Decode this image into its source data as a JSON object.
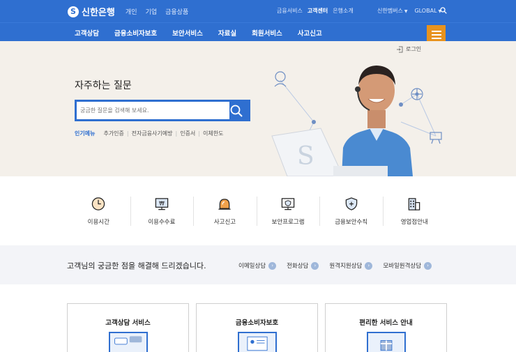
{
  "header": {
    "logo": "신한은행",
    "logo_mark": "S",
    "top_nav": [
      "개인",
      "기업",
      "금융상품"
    ],
    "top_right": [
      {
        "label": "금융서비스",
        "active": false
      },
      {
        "label": "고객센터",
        "active": true
      },
      {
        "label": "은행소개",
        "active": false
      }
    ],
    "util": [
      "신한멤버스",
      "GLOBAL"
    ]
  },
  "main_nav": [
    "고객상담",
    "금융소비자보호",
    "보안서비스",
    "자료실",
    "회원서비스",
    "사고신고"
  ],
  "hero": {
    "login": "로그인",
    "title": "자주하는 질문",
    "search_placeholder": "궁금한 질문을 검색해 보세요.",
    "quick_label": "인기메뉴",
    "quick_links": [
      "추가인증",
      "전자금융사기예방",
      "인증서",
      "이체한도"
    ]
  },
  "services": [
    {
      "label": "이용시간",
      "icon": "clock-icon"
    },
    {
      "label": "이용수수료",
      "icon": "fee-monitor-icon"
    },
    {
      "label": "사고신고",
      "icon": "alarm-bell-icon"
    },
    {
      "label": "보안프로그램",
      "icon": "security-monitor-icon"
    },
    {
      "label": "금융보안수칙",
      "icon": "shield-icon"
    },
    {
      "label": "영업점안내",
      "icon": "building-icon"
    }
  ],
  "band": {
    "text": "고객님의 궁금한 점을 해결해 드리겠습니다.",
    "links": [
      "이메일상담",
      "전화상담",
      "원격지원상담",
      "모바일원격상담"
    ]
  },
  "cards": [
    "고객상담 서비스",
    "금융소비자보호",
    "편리한 서비스 안내"
  ],
  "colors": {
    "brand": "#2f6fd0",
    "accent": "#e8931e",
    "hero_bg": "#f4f0ea",
    "band_bg": "#f3f4f8"
  }
}
